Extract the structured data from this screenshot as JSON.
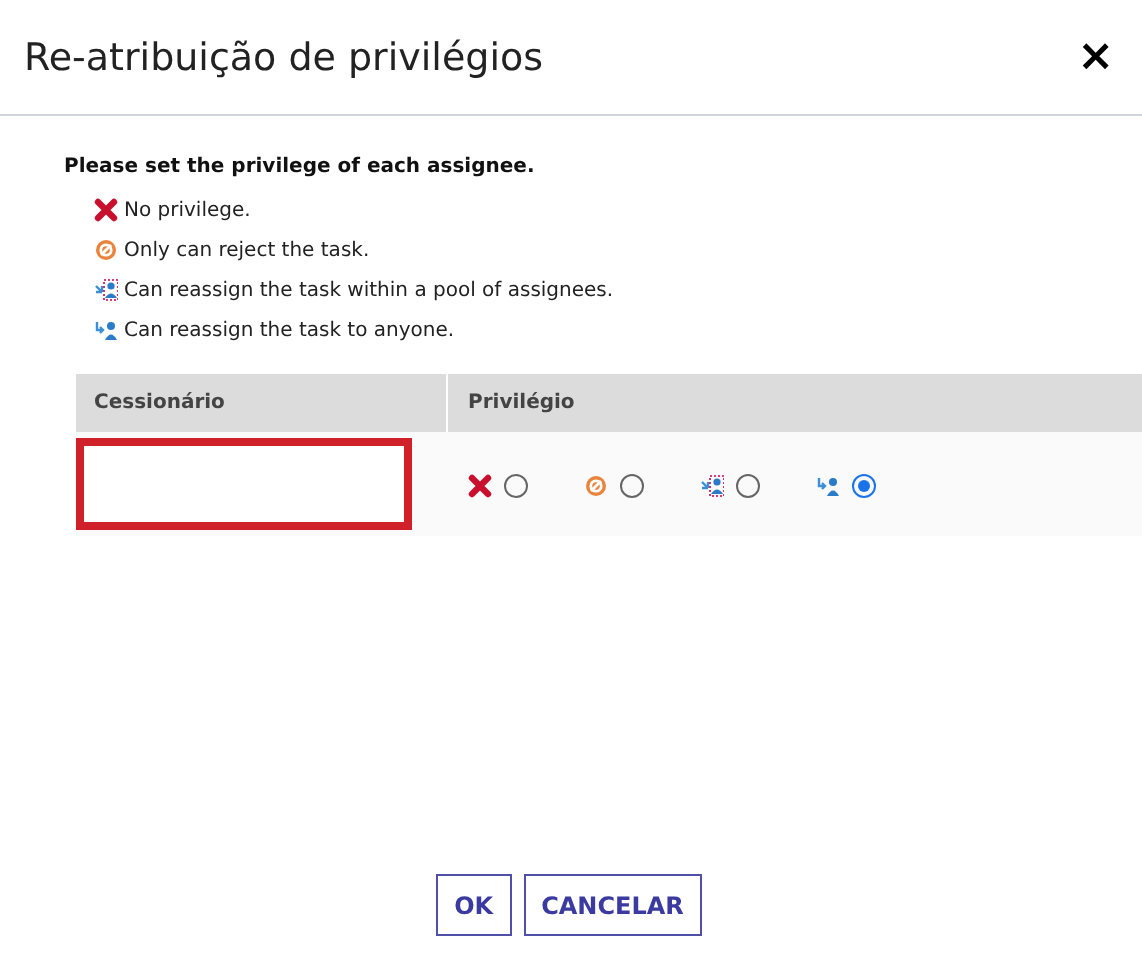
{
  "window": {
    "title": "Re-atribuição de privilégios",
    "close": "×"
  },
  "instruction": "Please set the privilege of each assignee.",
  "legend": [
    {
      "kind": "none",
      "label": "No privilege."
    },
    {
      "kind": "reject",
      "label": "Only can reject the task."
    },
    {
      "kind": "pool",
      "label": "Can reassign the task within a pool of assignees."
    },
    {
      "kind": "anyone",
      "label": "Can reassign the task to anyone."
    }
  ],
  "table": {
    "columns": [
      "Cessionário",
      "Privilégio"
    ],
    "rows": [
      {
        "highlighted": true,
        "options": [
          {
            "kind": "none",
            "selected": false
          },
          {
            "kind": "reject",
            "selected": false
          },
          {
            "kind": "pool",
            "selected": false
          },
          {
            "kind": "anyone",
            "selected": true
          }
        ]
      }
    ]
  },
  "buttons": [
    "OK",
    "CANCELAR"
  ]
}
